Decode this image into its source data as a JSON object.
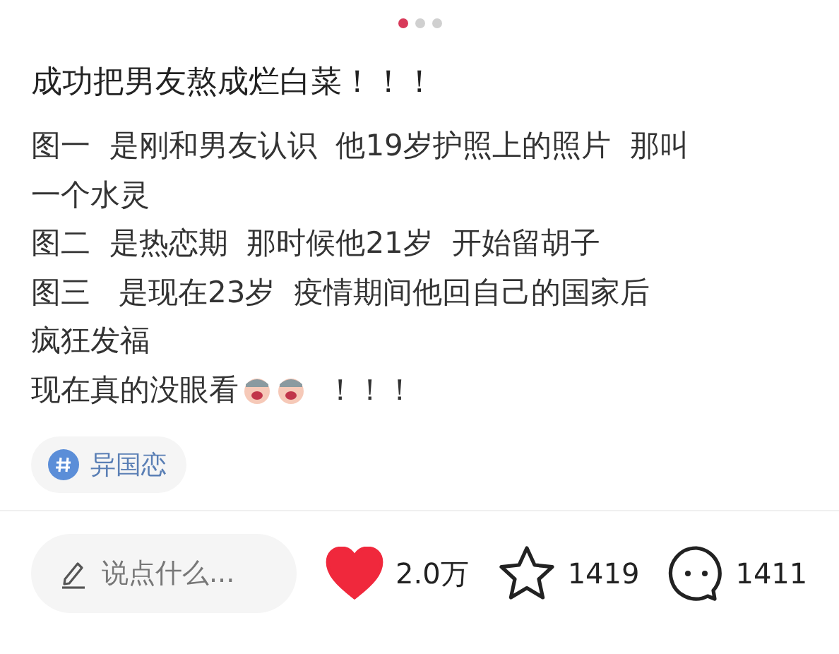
{
  "carousel": {
    "dots": [
      {
        "selected": true
      },
      {
        "selected": false
      },
      {
        "selected": false
      }
    ]
  },
  "title": "成功把男友熬成烂白菜！！！",
  "body": [
    {
      "kind": "text",
      "text": "图一  是刚和男友认识  他19岁护照上的照片  那叫"
    },
    {
      "kind": "text",
      "text": "一个水灵"
    },
    {
      "kind": "text",
      "text": "图二  是热恋期  那时候他21岁  开始留胡子"
    },
    {
      "kind": "text",
      "text": "图三   是现在23岁  疫情期间他回自己的国家后"
    },
    {
      "kind": "text",
      "text": "疯狂发福"
    },
    {
      "kind": "stickers",
      "text": "现在真的没眼看",
      "after": "！！！"
    }
  ],
  "tag": {
    "label": "异国恋"
  },
  "bottom_bar": {
    "comment_placeholder": "说点什么...",
    "like": {
      "liked": true,
      "count": "2.0万"
    },
    "collect": {
      "collected": false,
      "count": "1419"
    },
    "comments": {
      "count": "1411"
    }
  }
}
